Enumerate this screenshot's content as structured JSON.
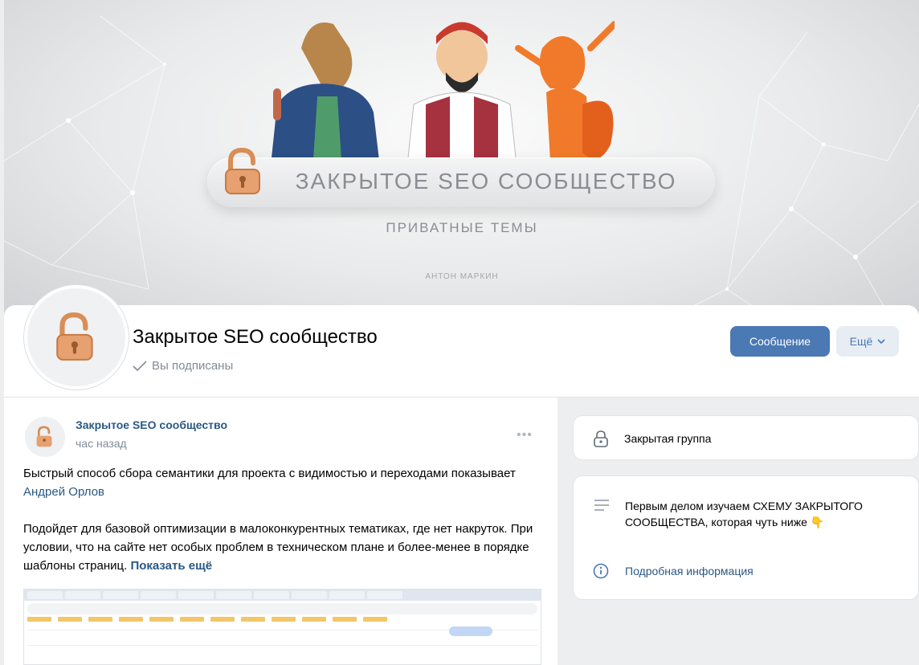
{
  "cover": {
    "title": "ЗАКРЫТОЕ SEO СООБЩЕСТВО",
    "subtitle": "ПРИВАТНЫЕ ТЕМЫ",
    "author": "АНТОН МАРКИН"
  },
  "header": {
    "group_name": "Закрытое SEO сообщество",
    "subscribed_label": "Вы подписаны",
    "message_button": "Сообщение",
    "more_button": "Ещё"
  },
  "post": {
    "author": "Закрытое SEO сообщество",
    "time": "час назад",
    "text_1_prefix": "Быстрый способ сбора семантики для проекта с видимостью и переходами показывает ",
    "text_1_link": "Андрей Орлов",
    "text_2": "Подойдет для базовой оптимизации в малоконкурентных тематиках, где нет накруток. При условии, что на сайте нет особых проблем в техническом плане и более-менее в порядке шаблоны страниц. ",
    "show_more": "Показать ещё"
  },
  "sidebar": {
    "closed_group": "Закрытая группа",
    "description": "Первым делом изучаем СХЕМУ ЗАКРЫТОГО СООБЩЕСТВА, которая чуть ниже 👇",
    "more_info": "Подробная информация"
  },
  "colors": {
    "accent": "#4a79b3",
    "link": "#2a5885",
    "secondary_text": "#818c99",
    "background": "#edeef0"
  }
}
